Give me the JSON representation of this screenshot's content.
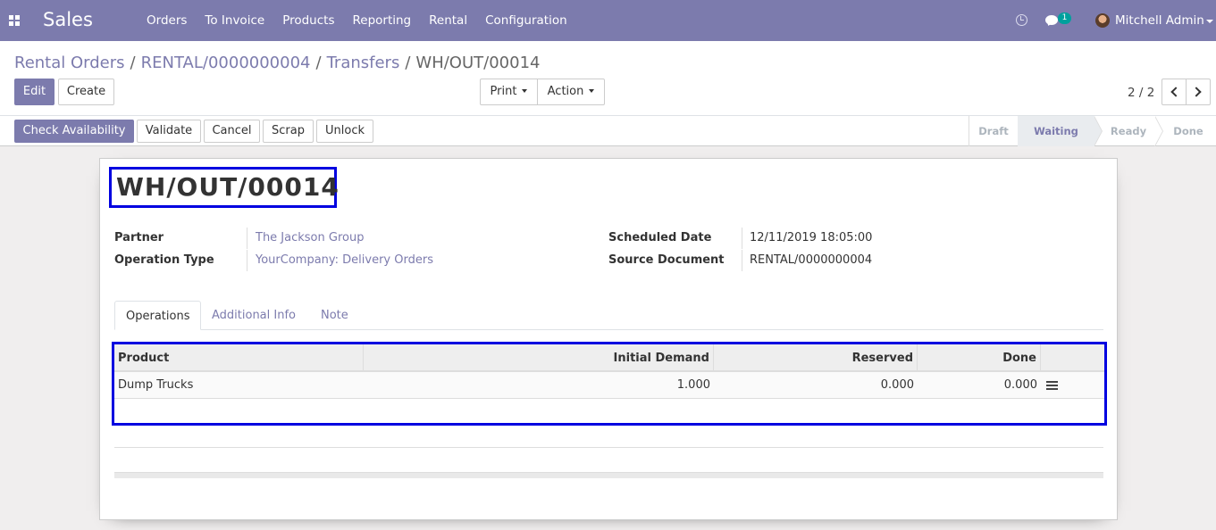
{
  "navbar": {
    "brand": "Sales",
    "menu": [
      "Orders",
      "To Invoice",
      "Products",
      "Reporting",
      "Rental",
      "Configuration"
    ],
    "chat_count": "1",
    "user_name": "Mitchell Admin"
  },
  "breadcrumb": {
    "items": [
      "Rental Orders",
      "RENTAL/0000000004",
      "Transfers"
    ],
    "separator": "/",
    "current": "WH/OUT/00014"
  },
  "toolbar": {
    "edit": "Edit",
    "create": "Create",
    "print": "Print",
    "action": "Action"
  },
  "pager": {
    "value": "2 / 2"
  },
  "statusbar": {
    "buttons": [
      "Check Availability",
      "Validate",
      "Cancel",
      "Scrap",
      "Unlock"
    ],
    "stages": [
      "Draft",
      "Waiting",
      "Ready",
      "Done"
    ],
    "active_stage": "Waiting"
  },
  "record": {
    "title": "WH/OUT/00014",
    "partner_label": "Partner",
    "partner_value": "The Jackson Group",
    "operation_type_label": "Operation Type",
    "operation_type_value": "YourCompany: Delivery Orders",
    "scheduled_date_label": "Scheduled Date",
    "scheduled_date_value": "12/11/2019 18:05:00",
    "source_document_label": "Source Document",
    "source_document_value": "RENTAL/0000000004"
  },
  "tabs": [
    "Operations",
    "Additional Info",
    "Note"
  ],
  "operations": {
    "columns": [
      "Product",
      "Initial Demand",
      "Reserved",
      "Done"
    ],
    "rows": [
      {
        "product": "Dump Trucks",
        "initial_demand": "1.000",
        "reserved": "0.000",
        "done": "0.000"
      }
    ]
  },
  "colors": {
    "brand": "#7c7bad",
    "highlight": "#0000e0"
  }
}
